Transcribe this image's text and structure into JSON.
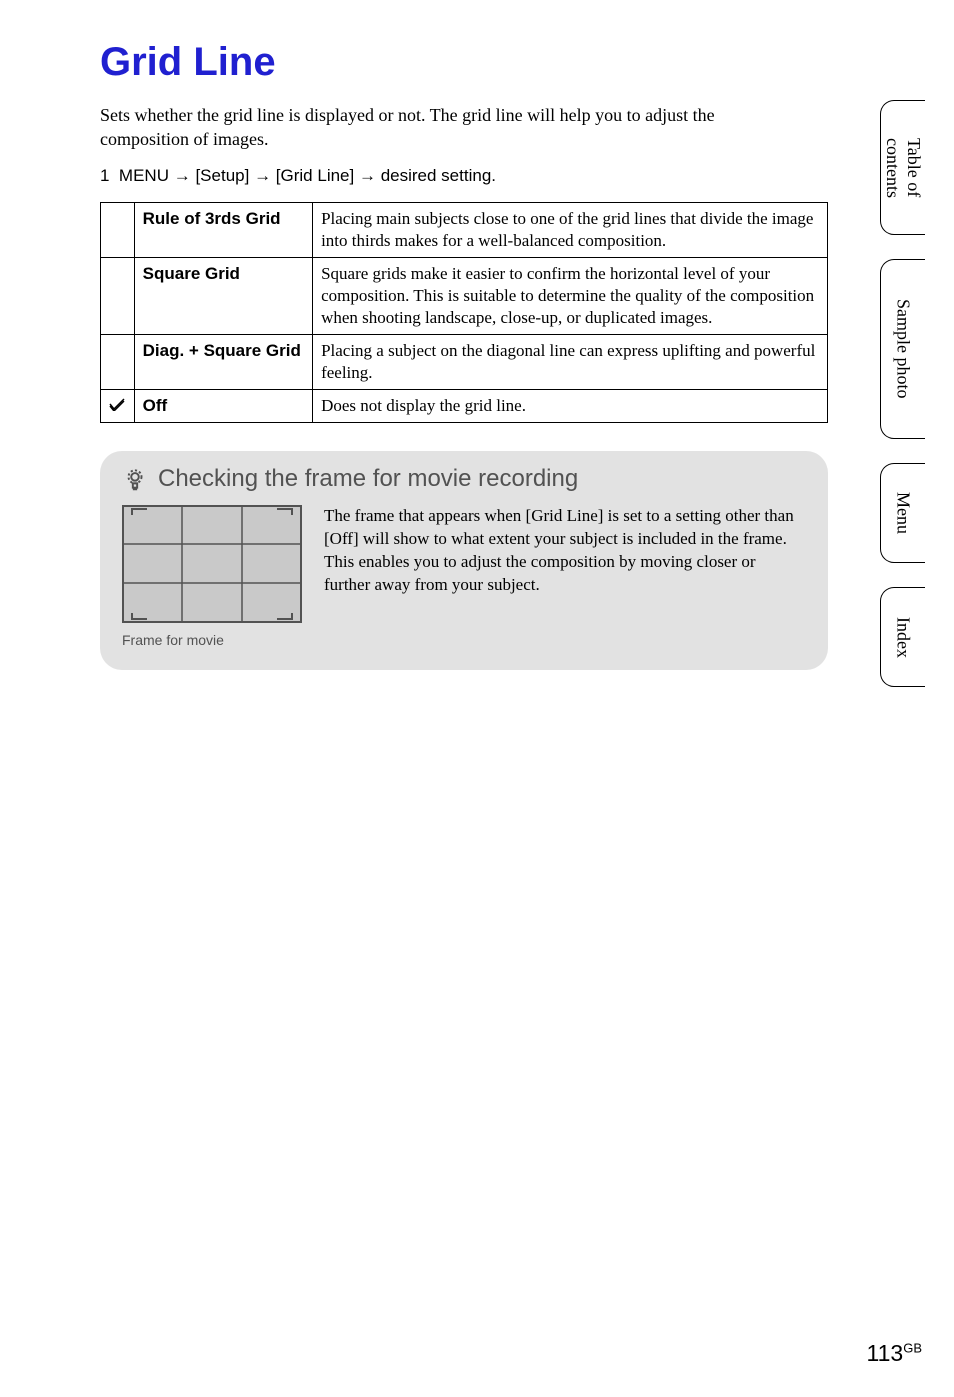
{
  "title": "Grid Line",
  "intro": "Sets whether the grid line is displayed or not. The grid line will help you to adjust the composition of images.",
  "step": {
    "num": "1",
    "prefix": "MENU",
    "arrow": "→",
    "p1": "[Setup]",
    "p2": "[Grid Line]",
    "p3": "desired setting."
  },
  "options": [
    {
      "check": "",
      "name": "Rule of 3rds Grid",
      "desc": "Placing main subjects close to one of the grid lines that divide the image into thirds makes for a well-balanced composition."
    },
    {
      "check": "",
      "name": "Square Grid",
      "desc": "Square grids make it easier to confirm the horizontal level of your composition. This is suitable to determine the quality of the composition when shooting landscape, close-up, or duplicated images."
    },
    {
      "check": "",
      "name": "Diag. + Square Grid",
      "desc": "Placing a subject on the diagonal line can express uplifting and powerful feeling."
    },
    {
      "check": "✓",
      "name": "Off",
      "desc": "Does not display the grid line."
    }
  ],
  "tip": {
    "heading": "Checking the frame for movie recording",
    "caption": "Frame for movie",
    "text": "The frame that appears when [Grid Line] is set to a setting other than [Off] will show to what extent your subject is included in the frame. This enables you to adjust the composition by moving closer or further away from your subject."
  },
  "tabs": {
    "toc": "Table of contents",
    "sample": "Sample photo",
    "menu": "Menu",
    "index": "Index"
  },
  "page_number": "113",
  "page_suffix": "GB"
}
